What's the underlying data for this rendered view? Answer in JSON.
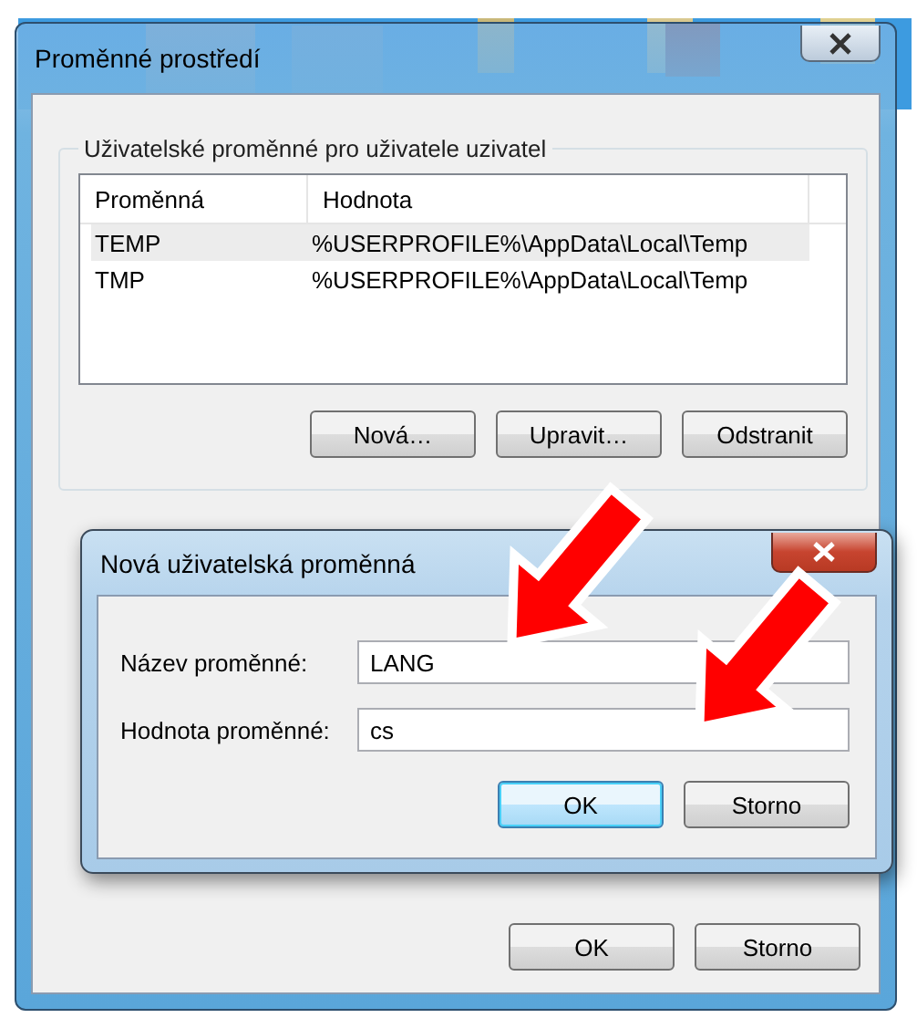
{
  "window": {
    "title": "Proměnné prostředí"
  },
  "user_variables": {
    "title": "Uživatelské proměnné pro uživatele uzivatel",
    "columns": [
      "Proměnná",
      "Hodnota"
    ],
    "rows": [
      {
        "cells": [
          "TEMP",
          "%USERPROFILE%\\AppData\\Local\\Temp"
        ],
        "selected": true
      },
      {
        "cells": [
          "TMP",
          "%USERPROFILE%\\AppData\\Local\\Temp"
        ],
        "selected": false
      }
    ],
    "buttons": [
      "Nová…",
      "Upravit…",
      "Odstranit"
    ]
  },
  "dialog": {
    "title": "Nová uživatelská proměnná",
    "fields": [
      {
        "label": "Název proměnné:",
        "value": "LANG"
      },
      {
        "label": "Hodnota proměnné:",
        "value": "cs"
      }
    ],
    "buttons": [
      {
        "label": "OK",
        "default": true
      },
      {
        "label": "Storno",
        "default": false
      }
    ]
  },
  "buttons": [
    "OK",
    "Storno"
  ]
}
